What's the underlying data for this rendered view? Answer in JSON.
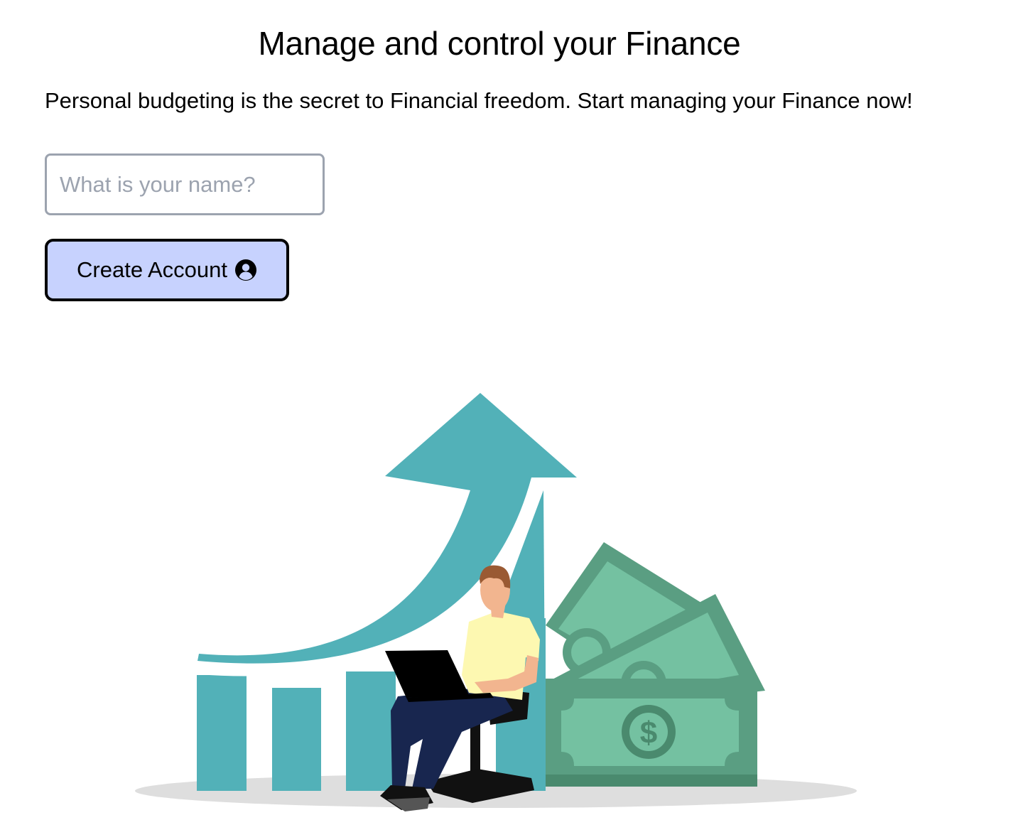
{
  "header": {
    "title": "Manage and control your Finance",
    "subtitle": "Personal budgeting is the secret to Financial freedom. Start managing your Finance now!"
  },
  "form": {
    "name_placeholder": "What is your name?",
    "name_value": "",
    "create_label": "Create Account",
    "create_icon": "user-circle-icon"
  },
  "illustration": {
    "subject": "growth-chart-person-laptop-money-icon",
    "colors": {
      "chart": "#52b1b8",
      "money_dark": "#5a9e82",
      "money_light": "#74c1a1",
      "shirt": "#fdf8b1",
      "pants": "#18264f",
      "skin": "#f2b58f",
      "hair": "#9a5a33",
      "shadow": "#dedede"
    }
  },
  "theme": {
    "button_bg": "#c7d2fe",
    "input_border": "#9ca3af"
  }
}
